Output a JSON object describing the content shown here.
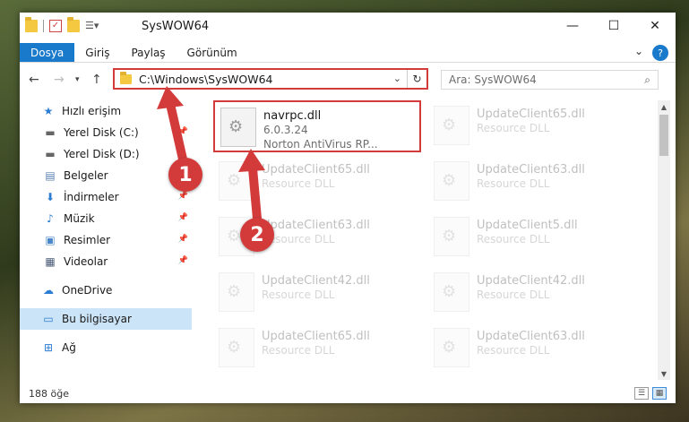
{
  "window": {
    "title": "SysWOW64",
    "controls": {
      "minimize": "—",
      "maximize": "☐",
      "close": "✕"
    }
  },
  "ribbon": {
    "tabs": [
      "Dosya",
      "Giriş",
      "Paylaş",
      "Görünüm"
    ],
    "help": "?"
  },
  "address": {
    "path": "C:\\Windows\\SysWOW64",
    "search_placeholder": "Ara: SysWOW64"
  },
  "sidebar": {
    "quick_access": "Hızlı erişim",
    "items": [
      {
        "label": "Yerel Disk (C:)",
        "icon": "drive-icon"
      },
      {
        "label": "Yerel Disk (D:)",
        "icon": "drive-icon"
      },
      {
        "label": "Belgeler",
        "icon": "documents-icon"
      },
      {
        "label": "İndirmeler",
        "icon": "download-icon"
      },
      {
        "label": "Müzik",
        "icon": "music-icon"
      },
      {
        "label": "Resimler",
        "icon": "pictures-icon"
      },
      {
        "label": "Videolar",
        "icon": "videos-icon"
      }
    ],
    "onedrive": "OneDrive",
    "this_pc": "Bu bilgisayar",
    "network": "Ağ"
  },
  "files": {
    "highlighted": {
      "name": "navrpc.dll",
      "version": "6.0.3.24",
      "company": "Norton AntiVirus RP..."
    },
    "background": [
      {
        "name": "UpdateClient65.dll",
        "type": "Resource DLL"
      },
      {
        "name": "UpdateClient65.dll",
        "type": "Resource DLL"
      },
      {
        "name": "UpdateClient63.dll",
        "type": "Resource DLL"
      },
      {
        "name": "UpdateClient63.dll",
        "type": "Resource DLL"
      },
      {
        "name": "UpdateClient5.dll",
        "type": "Resource DLL"
      },
      {
        "name": "UpdateClient42.dll",
        "type": "Resource DLL"
      },
      {
        "name": "UpdateClient42.dll",
        "type": "Resource DLL"
      },
      {
        "name": "UpdateClient65.dll",
        "type": "Resource DLL"
      },
      {
        "name": "UpdateClient63.dll",
        "type": "Resource DLL"
      }
    ]
  },
  "status": {
    "count": "188 öğe"
  },
  "annotations": {
    "step1": "1",
    "step2": "2",
    "color": "#d33b3b"
  }
}
